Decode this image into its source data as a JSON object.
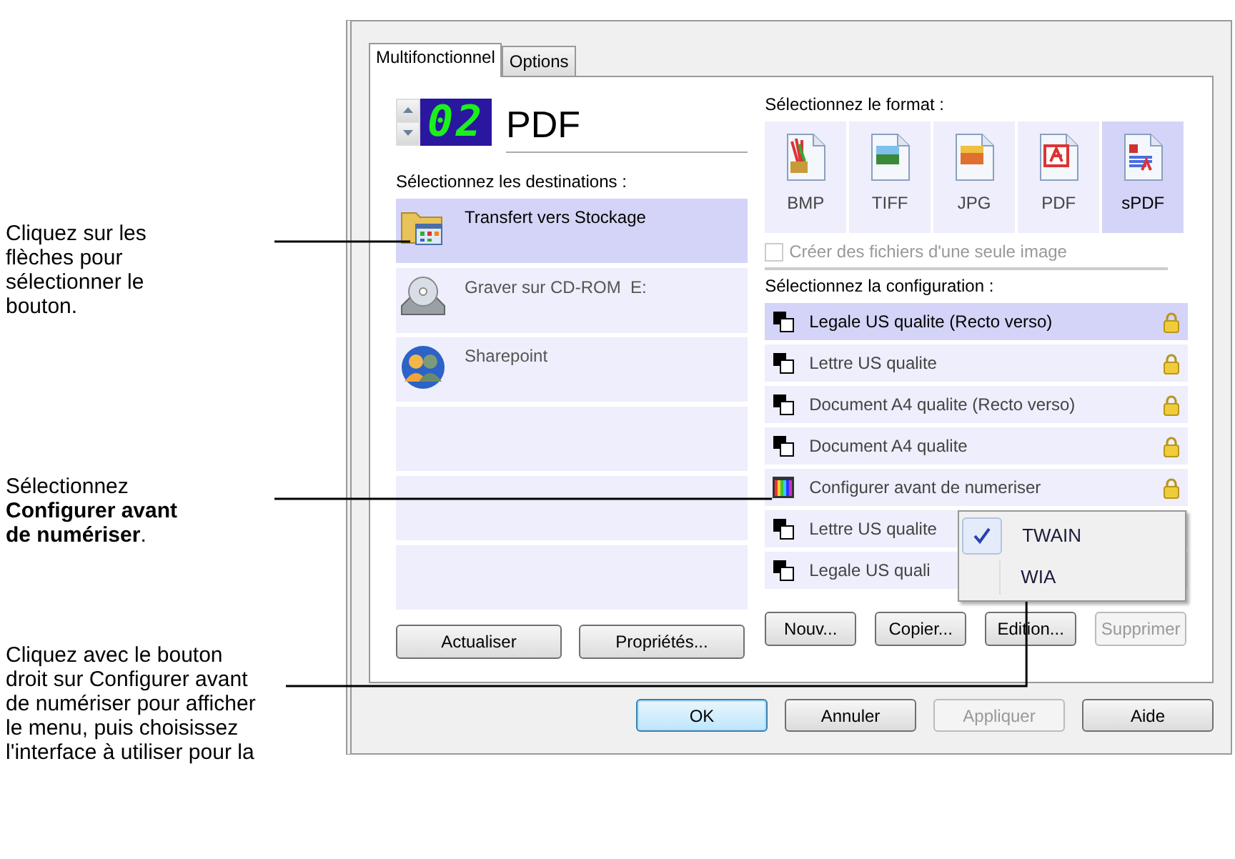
{
  "annotations": [
    {
      "text": "Cliquez sur les flèches pour sélectionner le bouton."
    },
    {
      "text": "Sélectionnez **Configurer avant de numériser**."
    },
    {
      "text": "Cliquez avec le bouton droit sur Configurer avant de numériser pour afficher le menu, puis choisissez l'interface à utiliser pour la"
    }
  ],
  "dialog": {
    "tabs": [
      {
        "label": "Multifonctionnel",
        "selected": true
      },
      {
        "label": "Options",
        "selected": false
      }
    ],
    "button_selector": {
      "number": "02",
      "name": "PDF"
    },
    "destinations": {
      "label": "Sélectionnez les destinations :",
      "items": [
        {
          "label": "Transfert vers Stockage",
          "kind": "folder",
          "selected": true
        },
        {
          "label": "Graver sur CD-ROM  E:",
          "kind": "disc",
          "selected": false
        },
        {
          "label": "Sharepoint",
          "kind": "people",
          "selected": false
        }
      ],
      "buttons": [
        {
          "label": "Actualiser",
          "disabled": false
        },
        {
          "label": "Propriétés...",
          "disabled": false
        }
      ]
    },
    "format": {
      "label": "Sélectionnez le format :",
      "options": [
        {
          "label": "BMP",
          "kind": "bmp",
          "selected": false
        },
        {
          "label": "TIFF",
          "kind": "tiff",
          "selected": false
        },
        {
          "label": "JPG",
          "kind": "jpg",
          "selected": false
        },
        {
          "label": "PDF",
          "kind": "pdf",
          "selected": false
        },
        {
          "label": "sPDF",
          "kind": "spdf",
          "selected": true
        }
      ],
      "single_image": {
        "label": "Créer des fichiers d'une seule image",
        "checked": false,
        "disabled": true
      }
    },
    "configuration": {
      "label": "Sélectionnez la configuration :",
      "items": [
        {
          "label": "Legale US qualite (Recto verso)",
          "kind": "document",
          "locked": true,
          "selected": true
        },
        {
          "label": "Lettre US qualite",
          "kind": "document",
          "locked": true,
          "selected": false
        },
        {
          "label": "Document A4 qualite (Recto verso)",
          "kind": "document",
          "locked": true,
          "selected": false
        },
        {
          "label": "Document A4 qualite",
          "kind": "document",
          "locked": true,
          "selected": false
        },
        {
          "label": "Configurer avant de numeriser",
          "kind": "color",
          "locked": true,
          "selected": false
        },
        {
          "label": "Lettre US qualite",
          "kind": "document",
          "selected": false
        },
        {
          "label": "Legale US quali",
          "kind": "document",
          "selected": false
        }
      ],
      "buttons": [
        {
          "label": "Nouv...",
          "disabled": false
        },
        {
          "label": "Copier...",
          "disabled": false
        },
        {
          "label": "Edition...",
          "disabled": false
        },
        {
          "label": "Supprimer",
          "disabled": true
        }
      ]
    },
    "context_menu": {
      "items": [
        {
          "label": "TWAIN",
          "checked": true
        },
        {
          "label": "WIA",
          "checked": false
        }
      ]
    },
    "footer_buttons": [
      {
        "label": "OK",
        "kind": "default",
        "disabled": false
      },
      {
        "label": "Annuler",
        "kind": "normal",
        "disabled": false
      },
      {
        "label": "Appliquer",
        "kind": "normal",
        "disabled": true
      },
      {
        "label": "Aide",
        "kind": "normal",
        "disabled": false
      }
    ]
  }
}
